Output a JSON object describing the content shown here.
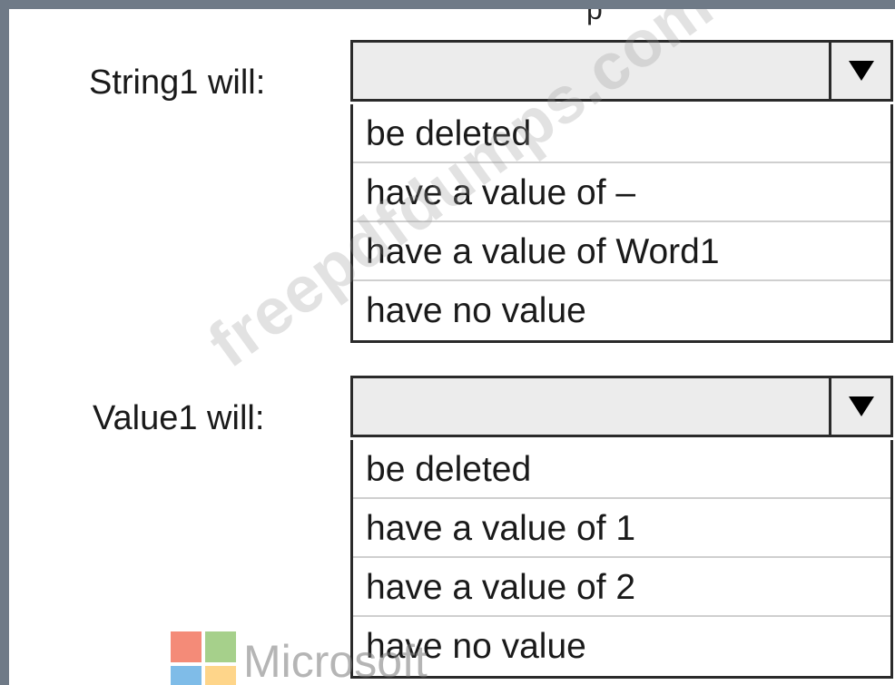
{
  "top_fragment": "p",
  "questions": [
    {
      "label": "String1 will:",
      "selected": "",
      "options": [
        "be deleted",
        "have a value of –",
        "have a value of Word1",
        "have no value"
      ]
    },
    {
      "label": "Value1 will:",
      "selected": "",
      "options": [
        "be deleted",
        "have a value of 1",
        "have a value of 2",
        "have no value"
      ]
    }
  ],
  "watermark": "freepdfdumps.com",
  "brand": {
    "text": "Microsoft",
    "colors": {
      "red": "#f48b78",
      "green": "#a6d08b",
      "blue": "#7fbce8",
      "yellow": "#fed58a"
    }
  },
  "icons": {
    "dropdown_arrow": "triangle-down-icon"
  }
}
